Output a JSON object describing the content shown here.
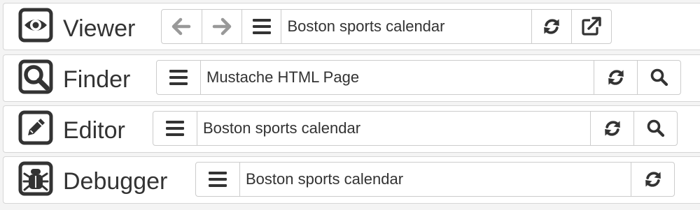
{
  "icon_color": "#333333",
  "arrow_color": "#999999",
  "viewer": {
    "name": "Viewer",
    "icon": "eye-icon",
    "title": "Boston sports calendar",
    "buttons": [
      "arrow-left-icon",
      "arrow-right-icon",
      "menu-icon",
      "refresh-icon",
      "external-link-icon"
    ]
  },
  "finder": {
    "name": "Finder",
    "icon": "magnifier-square-icon",
    "title": "Mustache HTML Page",
    "buttons": [
      "menu-icon",
      "refresh-icon",
      "search-icon"
    ]
  },
  "editor": {
    "name": "Editor",
    "icon": "pencil-square-icon",
    "title": "Boston sports calendar",
    "buttons": [
      "menu-icon",
      "refresh-icon",
      "search-icon"
    ]
  },
  "debugger": {
    "name": "Debugger",
    "icon": "bug-icon",
    "title": "Boston sports calendar",
    "buttons": [
      "menu-icon",
      "refresh-icon"
    ]
  }
}
